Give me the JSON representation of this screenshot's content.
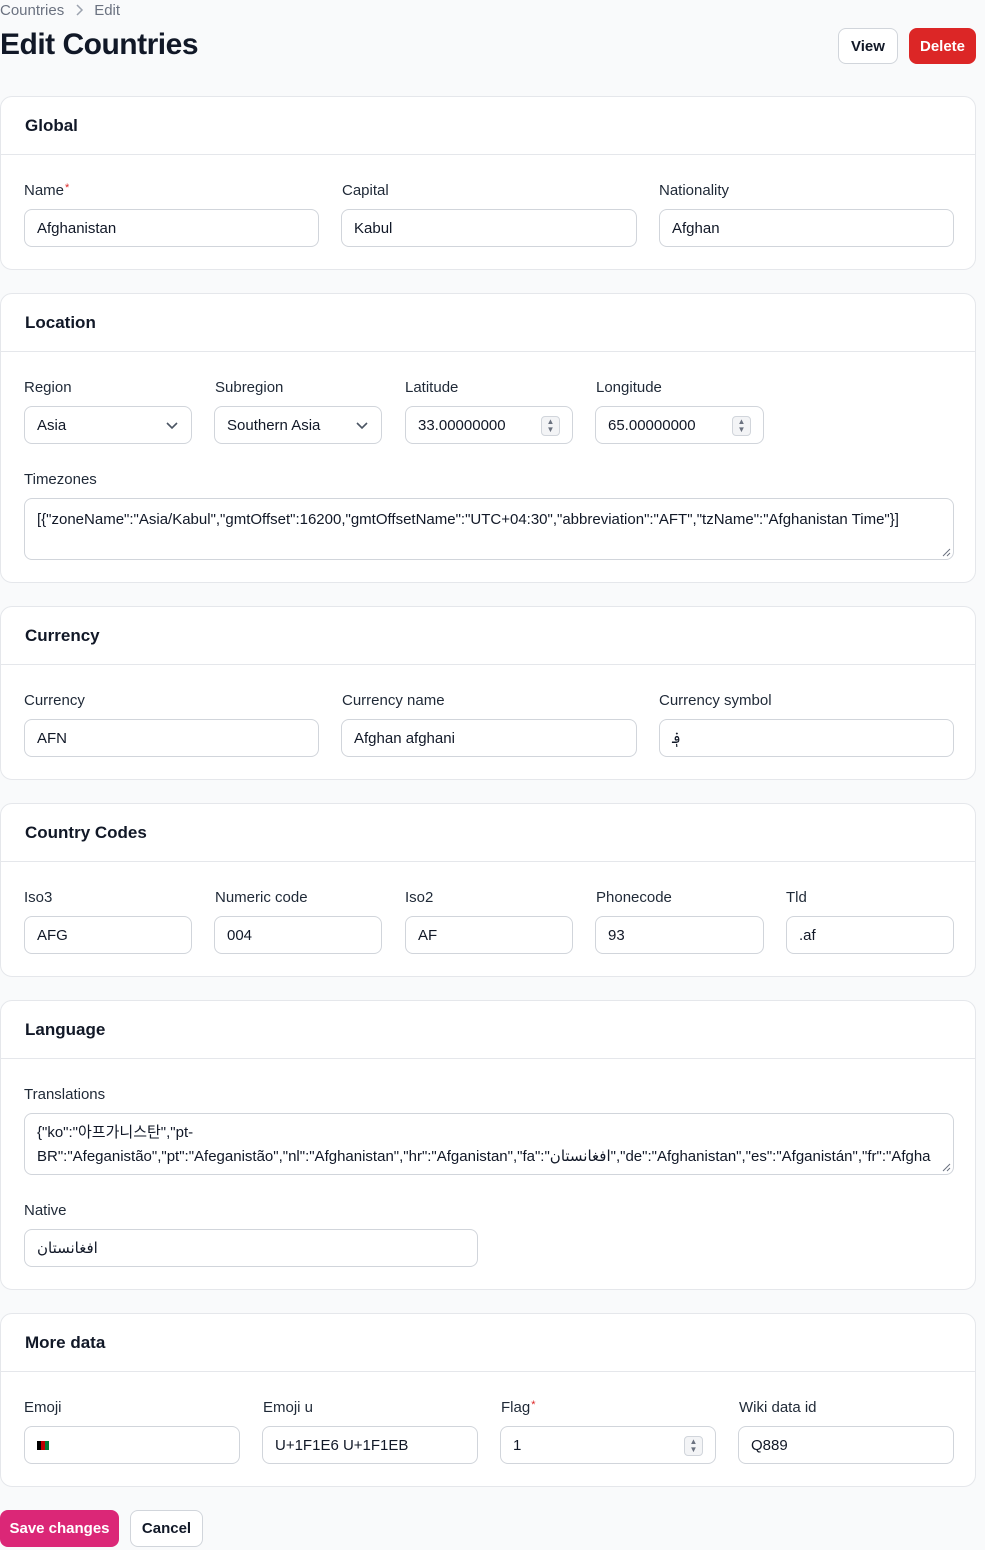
{
  "breadcrumb": {
    "parent": "Countries",
    "separator": ">",
    "current": "Edit"
  },
  "page": {
    "title": "Edit Countries"
  },
  "actions": {
    "view_label": "View",
    "delete_label": "Delete"
  },
  "sections": {
    "global": {
      "title": "Global",
      "name_label": "Name",
      "name_required": "*",
      "name_value": "Afghanistan",
      "capital_label": "Capital",
      "capital_value": "Kabul",
      "nationality_label": "Nationality",
      "nationality_value": "Afghan"
    },
    "location": {
      "title": "Location",
      "region_label": "Region",
      "region_value": "Asia",
      "subregion_label": "Subregion",
      "subregion_value": "Southern Asia",
      "latitude_label": "Latitude",
      "latitude_value": "33.00000000",
      "longitude_label": "Longitude",
      "longitude_value": "65.00000000",
      "timezones_label": "Timezones",
      "timezones_value": "[{\"zoneName\":\"Asia/Kabul\",\"gmtOffset\":16200,\"gmtOffsetName\":\"UTC+04:30\",\"abbreviation\":\"AFT\",\"tzName\":\"Afghanistan Time\"}]"
    },
    "currency": {
      "title": "Currency",
      "currency_label": "Currency",
      "currency_value": "AFN",
      "currency_name_label": "Currency name",
      "currency_name_value": "Afghan afghani",
      "currency_symbol_label": "Currency symbol",
      "currency_symbol_value": "؋"
    },
    "country_codes": {
      "title": "Country Codes",
      "iso3_label": "Iso3",
      "iso3_value": "AFG",
      "numeric_label": "Numeric code",
      "numeric_value": "004",
      "iso2_label": "Iso2",
      "iso2_value": "AF",
      "phonecode_label": "Phonecode",
      "phonecode_value": "93",
      "tld_label": "Tld",
      "tld_value": ".af"
    },
    "language": {
      "title": "Language",
      "translations_label": "Translations",
      "translations_line1": "{\"ko\":\"아프가니스탄\",\"pt-",
      "translations_line2": "BR\":\"Afeganistão\",\"pt\":\"Afeganistão\",\"nl\":\"Afghanistan\",\"hr\":\"Afganistan\",\"fa\":\"افغانستان\",\"de\":\"Afghanistan\",\"es\":\"Afganistán\",\"fr\":\"Afgha",
      "native_label": "Native",
      "native_value": "افغانستان"
    },
    "more_data": {
      "title": "More data",
      "emoji_label": "Emoji",
      "emoji_u_label": "Emoji u",
      "emoji_u_value": "U+1F1E6 U+1F1EB",
      "flag_label": "Flag",
      "flag_required": "*",
      "flag_value": "1",
      "wiki_label": "Wiki data id",
      "wiki_value": "Q889"
    }
  },
  "footer": {
    "save_label": "Save changes",
    "cancel_label": "Cancel"
  },
  "colors": {
    "primary": "#db2777",
    "danger": "#dc2626",
    "border": "#d1d5db",
    "background": "#f9fafb"
  },
  "icons": {
    "breadcrumb_separator": "chevron-right-icon",
    "select": "chevron-down-icon",
    "number": "spinner-icon",
    "emoji": "afghanistan-flag-icon"
  }
}
